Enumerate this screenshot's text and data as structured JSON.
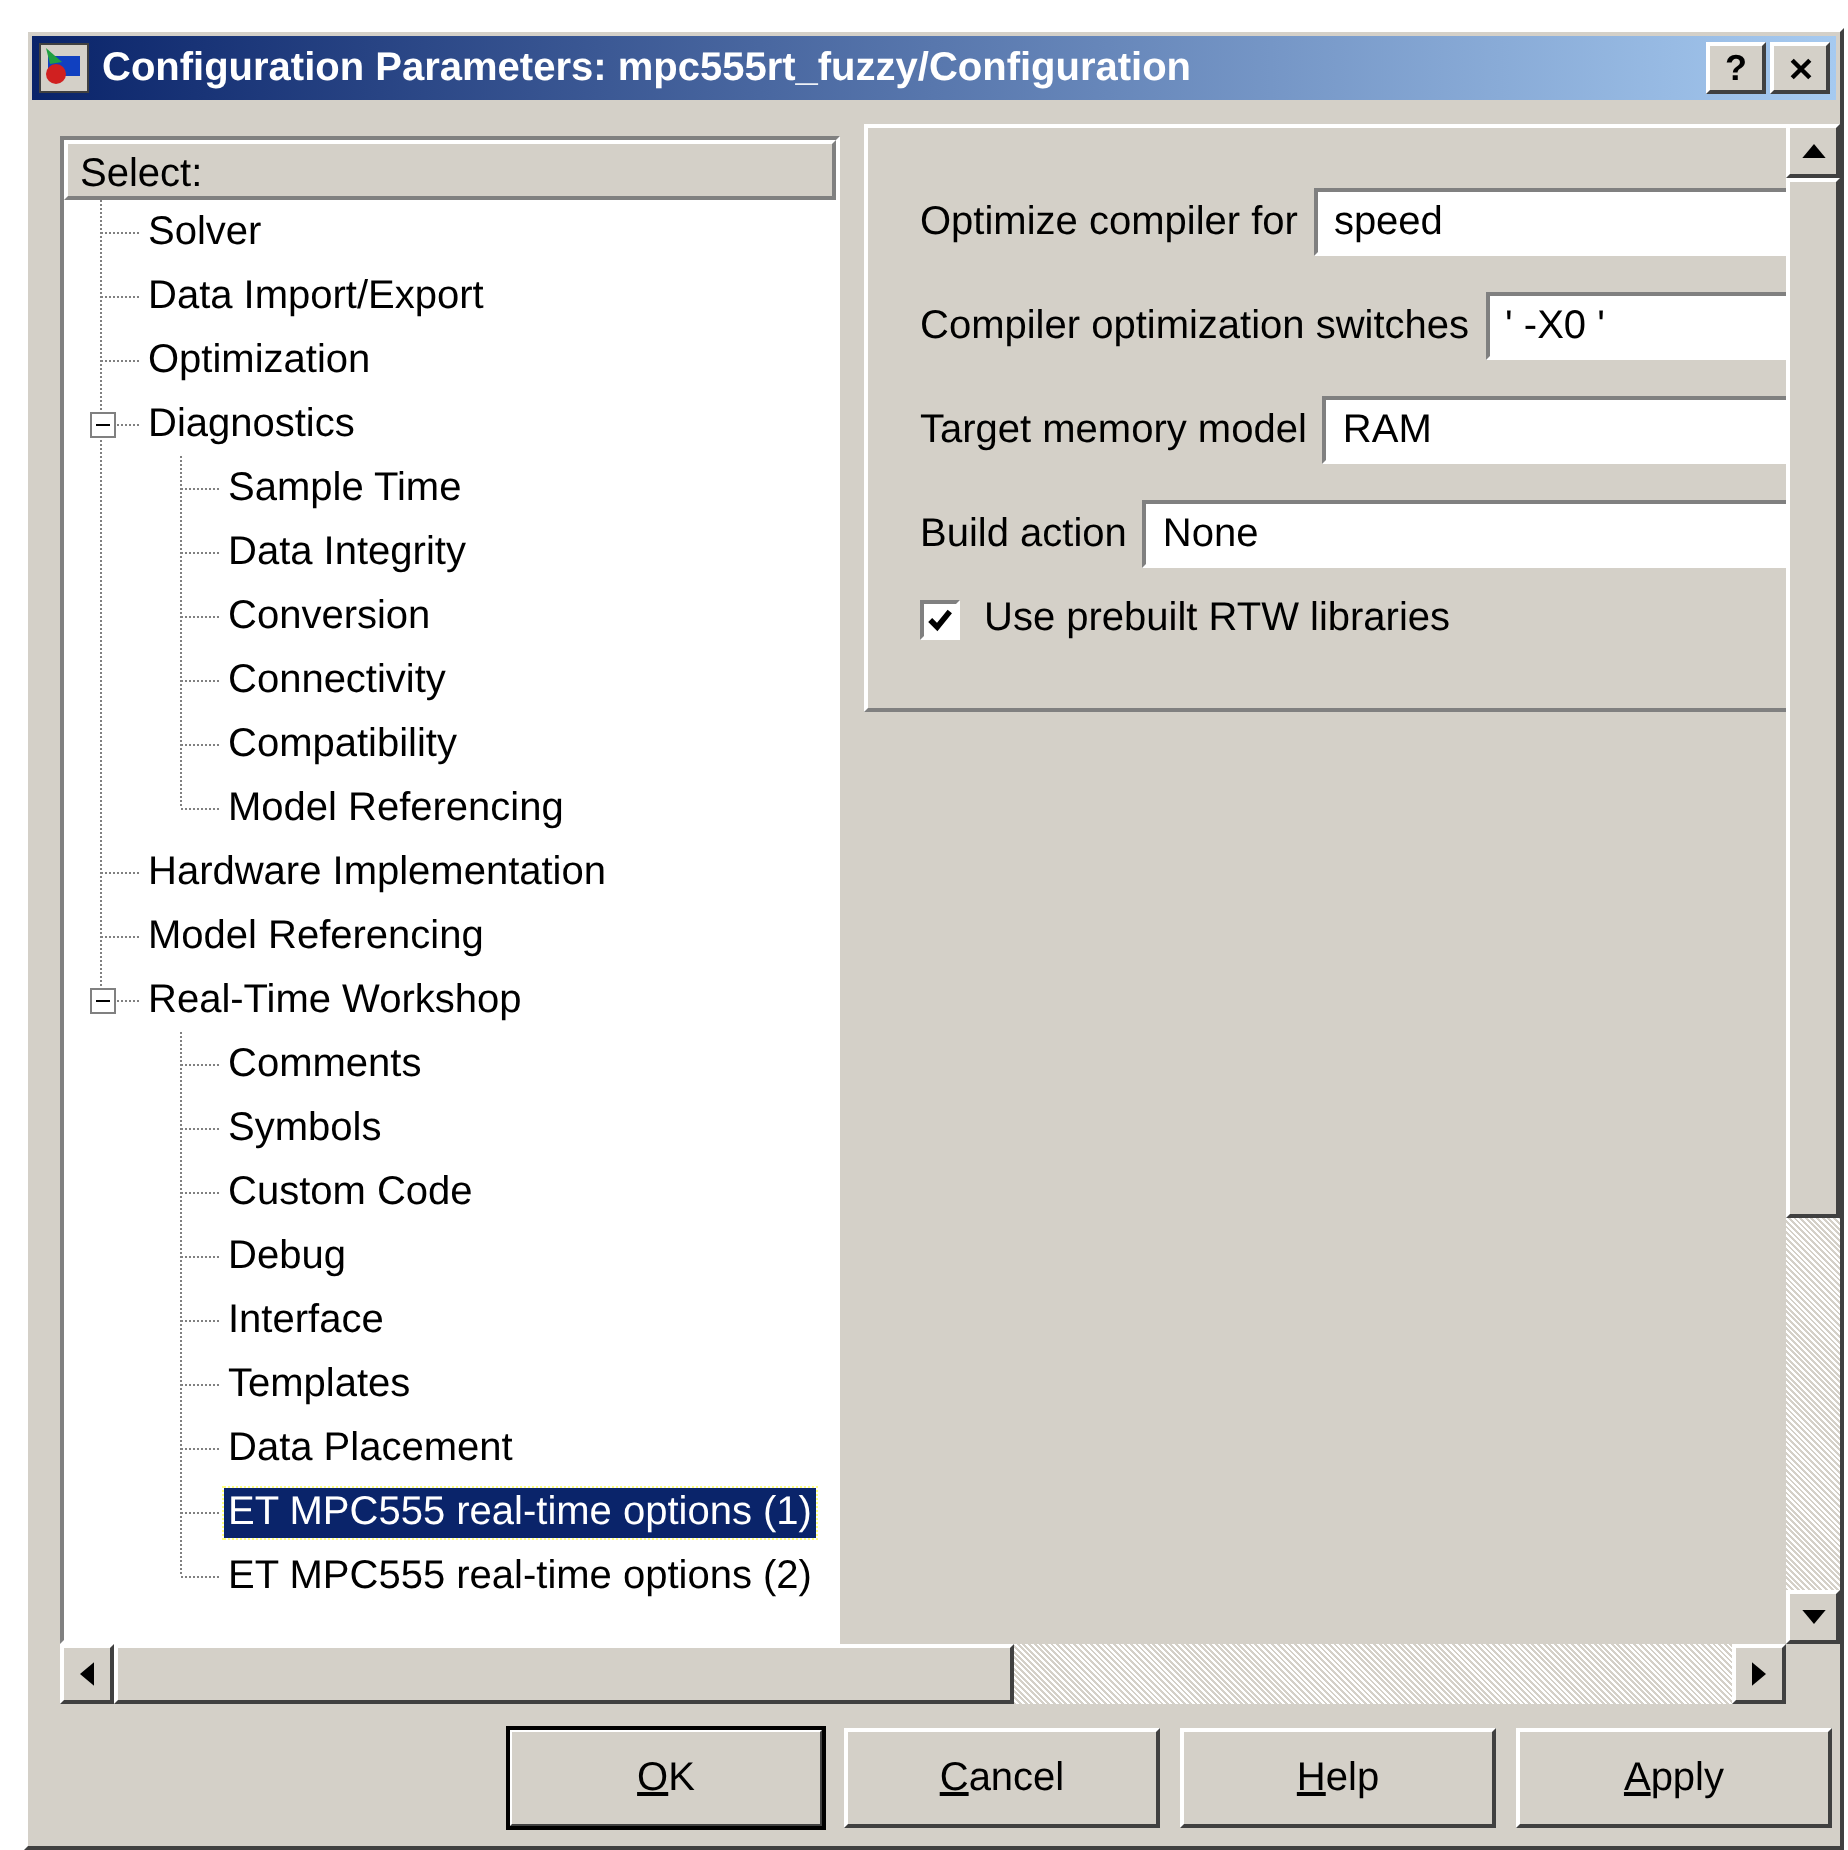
{
  "window": {
    "title": "Configuration Parameters: mpc555rt_fuzzy/Configuration",
    "title_buttons": [
      "?"
    ]
  },
  "tree": {
    "header": "Select:",
    "items": [
      {
        "label": "Solver",
        "selected": false
      },
      {
        "label": "Data Import/Export",
        "selected": false
      },
      {
        "label": "Optimization",
        "selected": false
      },
      {
        "label": "Diagnostics",
        "selected": false,
        "expanded": true,
        "children": [
          {
            "label": "Sample Time",
            "selected": false
          },
          {
            "label": "Data Integrity",
            "selected": false
          },
          {
            "label": "Conversion",
            "selected": false
          },
          {
            "label": "Connectivity",
            "selected": false
          },
          {
            "label": "Compatibility",
            "selected": false
          },
          {
            "label": "Model Referencing",
            "selected": false
          }
        ]
      },
      {
        "label": "Hardware Implementation",
        "selected": false
      },
      {
        "label": "Model Referencing",
        "selected": false
      },
      {
        "label": "Real-Time Workshop",
        "selected": false,
        "expanded": true,
        "children": [
          {
            "label": "Comments",
            "selected": false
          },
          {
            "label": "Symbols",
            "selected": false
          },
          {
            "label": "Custom Code",
            "selected": false
          },
          {
            "label": "Debug",
            "selected": false
          },
          {
            "label": "Interface",
            "selected": false
          },
          {
            "label": "Templates",
            "selected": false
          },
          {
            "label": "Data Placement",
            "selected": false
          },
          {
            "label": "ET MPC555 real-time options (1)",
            "selected": true
          },
          {
            "label": "ET MPC555 real-time options (2)",
            "selected": false
          }
        ]
      }
    ]
  },
  "settings": [
    {
      "kind": "field",
      "label": "Optimize compiler for",
      "value": "speed"
    },
    {
      "kind": "field",
      "label": "Compiler optimization switches",
      "value": "' -X0 '"
    },
    {
      "kind": "field",
      "label": "Target memory model",
      "value": "RAM"
    },
    {
      "kind": "field",
      "label": "Build action",
      "value": "None"
    },
    {
      "kind": "checkbox",
      "label": "Use prebuilt RTW libraries",
      "checked": true
    }
  ],
  "buttons": [
    {
      "label": "OK",
      "default": true
    },
    {
      "label": "Cancel",
      "default": false
    },
    {
      "label": "Help",
      "default": false
    },
    {
      "label": "Apply",
      "default": false
    }
  ]
}
